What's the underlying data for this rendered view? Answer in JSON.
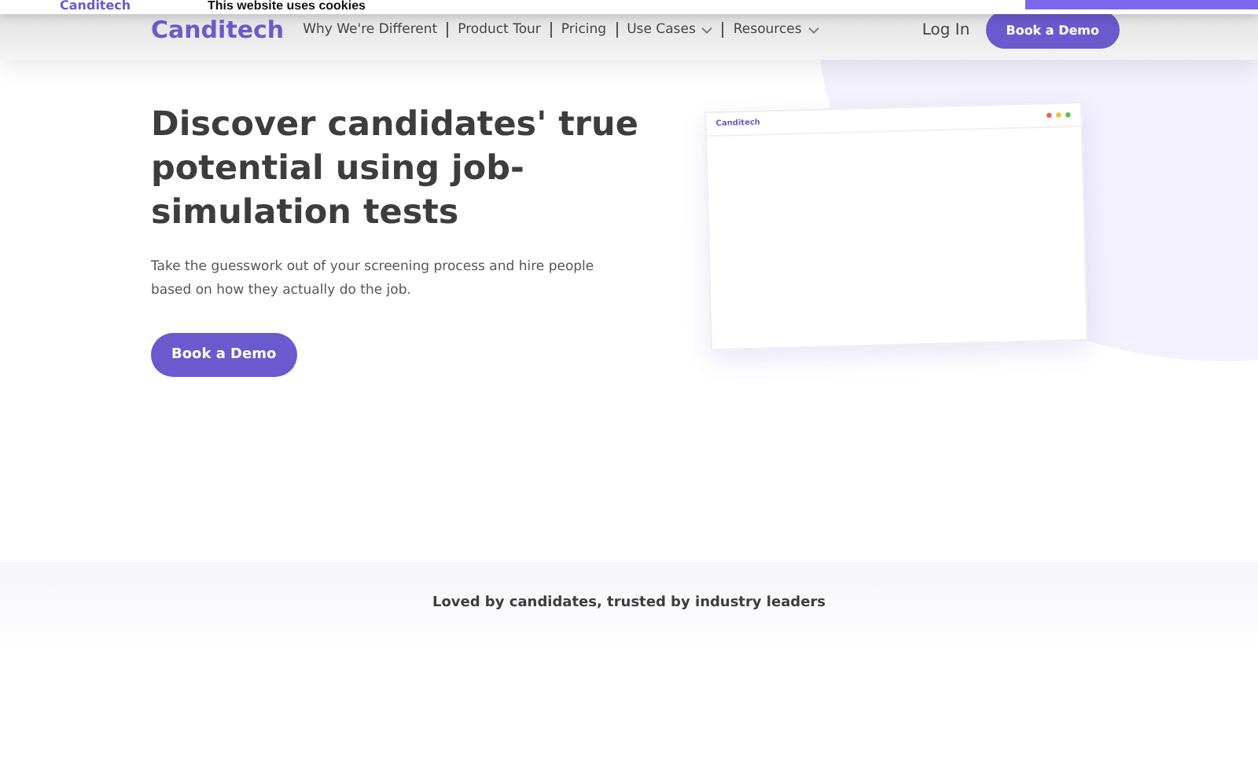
{
  "cookie_banner": {
    "logo": "Canditech",
    "title": "This website uses cookies"
  },
  "nav": {
    "logo": "Canditech",
    "links": [
      {
        "label": "Why We're Different",
        "dropdown": false
      },
      {
        "label": "Product Tour",
        "dropdown": false
      },
      {
        "label": "Pricing",
        "dropdown": false
      },
      {
        "label": "Use Cases",
        "dropdown": true
      },
      {
        "label": "Resources",
        "dropdown": true
      }
    ],
    "login": "Log In",
    "cta": "Book a Demo"
  },
  "hero": {
    "heading": "Discover candidates' true potential using job-simulation tests",
    "subtitle": "Take the guesswork out of your screening process and hire people based on how they actually do the job.",
    "cta": "Book a Demo",
    "mockup_logo": "Canditech"
  },
  "trust": {
    "heading": "Loved by candidates, trusted by industry leaders"
  }
}
